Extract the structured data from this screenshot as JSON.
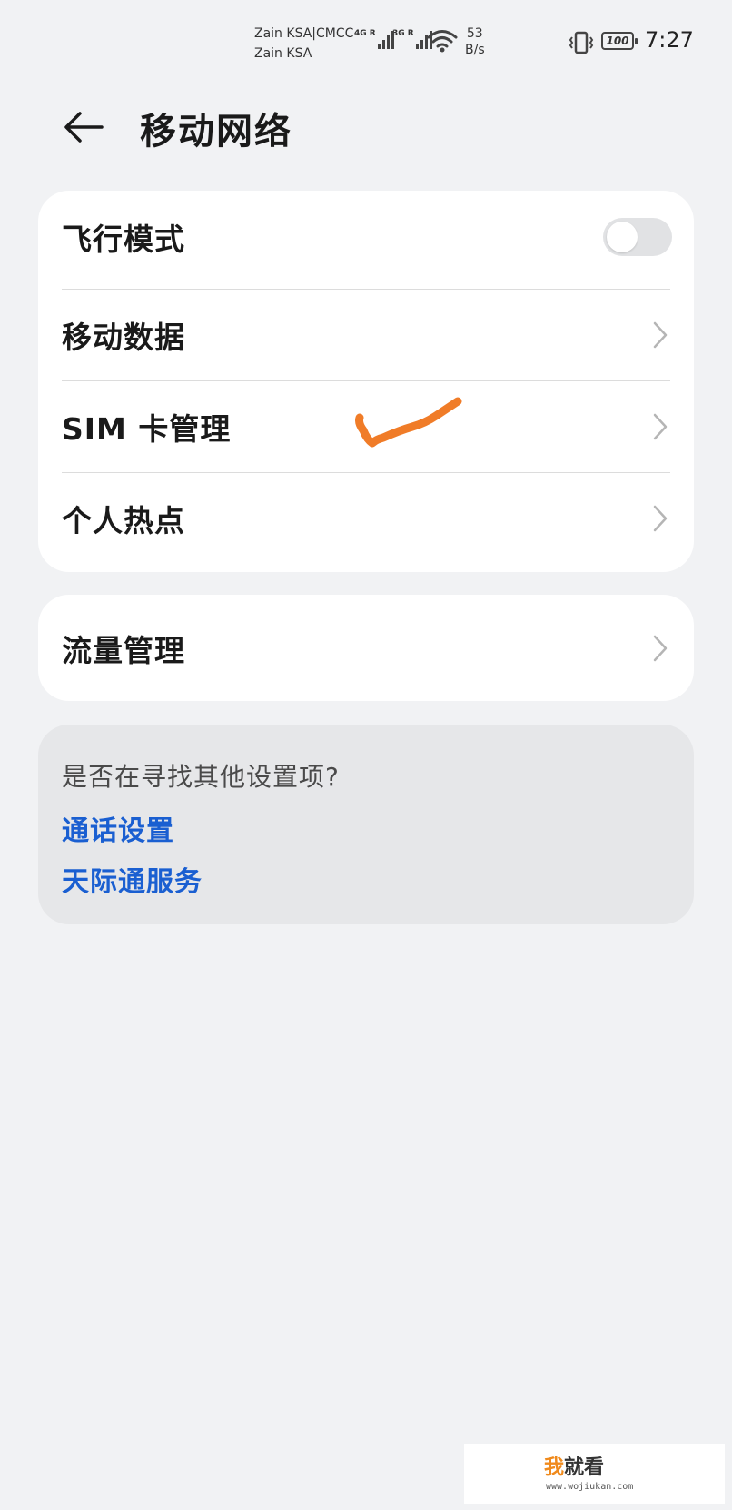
{
  "status_bar": {
    "carrier_line1": "Zain KSA|CMCC",
    "carrier_line2": "Zain KSA",
    "sim1_network": "4G",
    "sim1_roaming": "R",
    "sim2_network": "3G",
    "sim2_roaming": "R",
    "speed_value": "53",
    "speed_unit": "B/s",
    "battery": "100",
    "time": "7:27"
  },
  "header": {
    "title": "移动网络",
    "back_icon": "arrow-left-icon"
  },
  "settings_group_1": {
    "airplane_mode": {
      "label": "飞行模式",
      "enabled": false
    },
    "mobile_data": {
      "label": "移动数据"
    },
    "sim_management": {
      "label": "SIM 卡管理"
    },
    "hotspot": {
      "label": "个人热点"
    }
  },
  "settings_group_2": {
    "data_usage": {
      "label": "流量管理"
    }
  },
  "suggestions": {
    "question": "是否在寻找其他设置项?",
    "links": [
      "通话设置",
      "天际通服务"
    ]
  },
  "annotation_color": "#f07c28",
  "accent_link_color": "#1a5fd1",
  "watermark": {
    "brand_char1": "我",
    "brand_rest": "就看",
    "url": "www.wojiukan.com"
  }
}
